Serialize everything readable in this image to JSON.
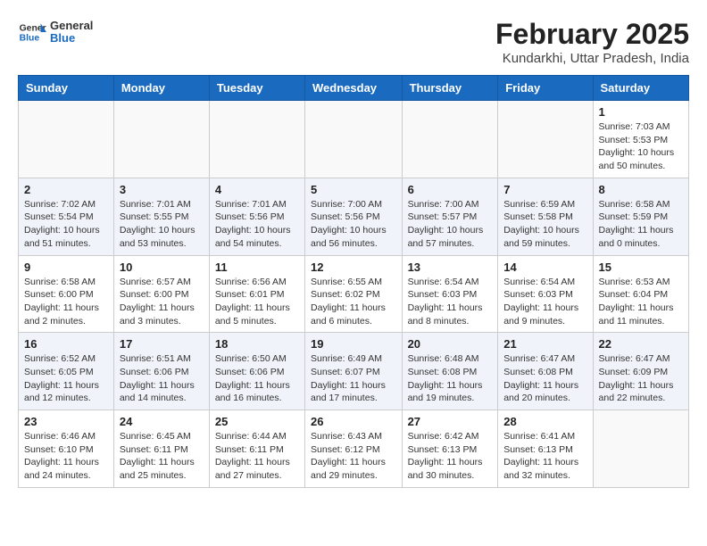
{
  "header": {
    "logo_general": "General",
    "logo_blue": "Blue",
    "month_year": "February 2025",
    "location": "Kundarkhi, Uttar Pradesh, India"
  },
  "weekdays": [
    "Sunday",
    "Monday",
    "Tuesday",
    "Wednesday",
    "Thursday",
    "Friday",
    "Saturday"
  ],
  "weeks": [
    [
      {
        "day": "",
        "info": ""
      },
      {
        "day": "",
        "info": ""
      },
      {
        "day": "",
        "info": ""
      },
      {
        "day": "",
        "info": ""
      },
      {
        "day": "",
        "info": ""
      },
      {
        "day": "",
        "info": ""
      },
      {
        "day": "1",
        "info": "Sunrise: 7:03 AM\nSunset: 5:53 PM\nDaylight: 10 hours and 50 minutes."
      }
    ],
    [
      {
        "day": "2",
        "info": "Sunrise: 7:02 AM\nSunset: 5:54 PM\nDaylight: 10 hours and 51 minutes."
      },
      {
        "day": "3",
        "info": "Sunrise: 7:01 AM\nSunset: 5:55 PM\nDaylight: 10 hours and 53 minutes."
      },
      {
        "day": "4",
        "info": "Sunrise: 7:01 AM\nSunset: 5:56 PM\nDaylight: 10 hours and 54 minutes."
      },
      {
        "day": "5",
        "info": "Sunrise: 7:00 AM\nSunset: 5:56 PM\nDaylight: 10 hours and 56 minutes."
      },
      {
        "day": "6",
        "info": "Sunrise: 7:00 AM\nSunset: 5:57 PM\nDaylight: 10 hours and 57 minutes."
      },
      {
        "day": "7",
        "info": "Sunrise: 6:59 AM\nSunset: 5:58 PM\nDaylight: 10 hours and 59 minutes."
      },
      {
        "day": "8",
        "info": "Sunrise: 6:58 AM\nSunset: 5:59 PM\nDaylight: 11 hours and 0 minutes."
      }
    ],
    [
      {
        "day": "9",
        "info": "Sunrise: 6:58 AM\nSunset: 6:00 PM\nDaylight: 11 hours and 2 minutes."
      },
      {
        "day": "10",
        "info": "Sunrise: 6:57 AM\nSunset: 6:00 PM\nDaylight: 11 hours and 3 minutes."
      },
      {
        "day": "11",
        "info": "Sunrise: 6:56 AM\nSunset: 6:01 PM\nDaylight: 11 hours and 5 minutes."
      },
      {
        "day": "12",
        "info": "Sunrise: 6:55 AM\nSunset: 6:02 PM\nDaylight: 11 hours and 6 minutes."
      },
      {
        "day": "13",
        "info": "Sunrise: 6:54 AM\nSunset: 6:03 PM\nDaylight: 11 hours and 8 minutes."
      },
      {
        "day": "14",
        "info": "Sunrise: 6:54 AM\nSunset: 6:03 PM\nDaylight: 11 hours and 9 minutes."
      },
      {
        "day": "15",
        "info": "Sunrise: 6:53 AM\nSunset: 6:04 PM\nDaylight: 11 hours and 11 minutes."
      }
    ],
    [
      {
        "day": "16",
        "info": "Sunrise: 6:52 AM\nSunset: 6:05 PM\nDaylight: 11 hours and 12 minutes."
      },
      {
        "day": "17",
        "info": "Sunrise: 6:51 AM\nSunset: 6:06 PM\nDaylight: 11 hours and 14 minutes."
      },
      {
        "day": "18",
        "info": "Sunrise: 6:50 AM\nSunset: 6:06 PM\nDaylight: 11 hours and 16 minutes."
      },
      {
        "day": "19",
        "info": "Sunrise: 6:49 AM\nSunset: 6:07 PM\nDaylight: 11 hours and 17 minutes."
      },
      {
        "day": "20",
        "info": "Sunrise: 6:48 AM\nSunset: 6:08 PM\nDaylight: 11 hours and 19 minutes."
      },
      {
        "day": "21",
        "info": "Sunrise: 6:47 AM\nSunset: 6:08 PM\nDaylight: 11 hours and 20 minutes."
      },
      {
        "day": "22",
        "info": "Sunrise: 6:47 AM\nSunset: 6:09 PM\nDaylight: 11 hours and 22 minutes."
      }
    ],
    [
      {
        "day": "23",
        "info": "Sunrise: 6:46 AM\nSunset: 6:10 PM\nDaylight: 11 hours and 24 minutes."
      },
      {
        "day": "24",
        "info": "Sunrise: 6:45 AM\nSunset: 6:11 PM\nDaylight: 11 hours and 25 minutes."
      },
      {
        "day": "25",
        "info": "Sunrise: 6:44 AM\nSunset: 6:11 PM\nDaylight: 11 hours and 27 minutes."
      },
      {
        "day": "26",
        "info": "Sunrise: 6:43 AM\nSunset: 6:12 PM\nDaylight: 11 hours and 29 minutes."
      },
      {
        "day": "27",
        "info": "Sunrise: 6:42 AM\nSunset: 6:13 PM\nDaylight: 11 hours and 30 minutes."
      },
      {
        "day": "28",
        "info": "Sunrise: 6:41 AM\nSunset: 6:13 PM\nDaylight: 11 hours and 32 minutes."
      },
      {
        "day": "",
        "info": ""
      }
    ]
  ]
}
